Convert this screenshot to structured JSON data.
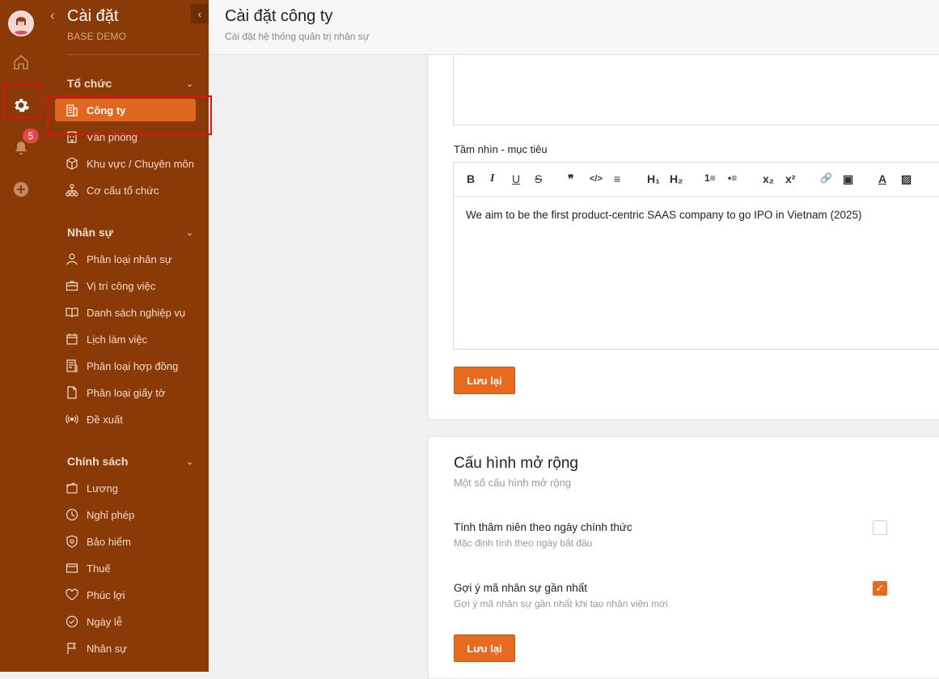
{
  "sidebar": {
    "title": "Cài đặt",
    "subtitle": "BASE DEMO",
    "notification_count": "5",
    "groups": [
      {
        "label": "Tổ chức"
      },
      {
        "label": "Nhân sự"
      },
      {
        "label": "Chính sách"
      }
    ],
    "items": [
      {
        "label": "Công ty",
        "icon": "building-icon"
      },
      {
        "label": "Văn phòng",
        "icon": "office-icon"
      },
      {
        "label": "Khu vực / Chuyên môn",
        "icon": "cube-icon"
      },
      {
        "label": "Cơ cấu tổ chức",
        "icon": "org-chart-icon"
      },
      {
        "label": "Phân loại nhân sự",
        "icon": "user-icon"
      },
      {
        "label": "Vị trí công việc",
        "icon": "briefcase-icon"
      },
      {
        "label": "Danh sách nghiệp vụ",
        "icon": "book-icon"
      },
      {
        "label": "Lịch làm việc",
        "icon": "calendar-icon"
      },
      {
        "label": "Phân loại hợp đồng",
        "icon": "contract-icon"
      },
      {
        "label": "Phân loại giấy tờ",
        "icon": "document-icon"
      },
      {
        "label": "Đề xuất",
        "icon": "broadcast-icon"
      },
      {
        "label": "Lương",
        "icon": "wallet-icon"
      },
      {
        "label": "Nghỉ phép",
        "icon": "clock-icon"
      },
      {
        "label": "Bảo hiểm",
        "icon": "shield-icon"
      },
      {
        "label": "Thuế",
        "icon": "tax-icon"
      },
      {
        "label": "Phúc lợi",
        "icon": "heart-icon"
      },
      {
        "label": "Ngày lễ",
        "icon": "check-circle-icon"
      },
      {
        "label": "Nhân sự",
        "icon": "flag-icon"
      }
    ]
  },
  "header": {
    "title": "Cài đặt công ty",
    "subtitle": "Cài đặt hệ thống quản trị nhân sự"
  },
  "vision": {
    "label": "Tầm nhìn - mục tiêu",
    "content": "We aim to be the first product-centric SAAS company to go IPO in Vietnam (2025)",
    "toolbar": [
      "B",
      "I",
      "U",
      "S",
      "❞",
      "</>",
      "≡",
      "H₁",
      "H₂",
      "1≡",
      "•≡",
      "x₂",
      "x²",
      "🔗",
      "▣",
      "A",
      "▨"
    ],
    "save_label": "Lưu lại"
  },
  "extended": {
    "title": "Cấu hình mở rộng",
    "subtitle": "Một số cấu hình mở rộng",
    "options": [
      {
        "label": "Tính thâm niên theo ngày chính thức",
        "hint": "Mặc định tính theo ngày bắt đầu",
        "checked": false
      },
      {
        "label": "Gợi ý mã nhân sự gần nhất",
        "hint": "Gợi ý mã nhân sự gần nhất khi tạo nhân viên mới",
        "checked": true
      }
    ],
    "save_label": "Lưu lại"
  },
  "colors": {
    "sidebar": "#8a3a06",
    "accent": "#e86a1e",
    "highlight": "#e3101a"
  }
}
